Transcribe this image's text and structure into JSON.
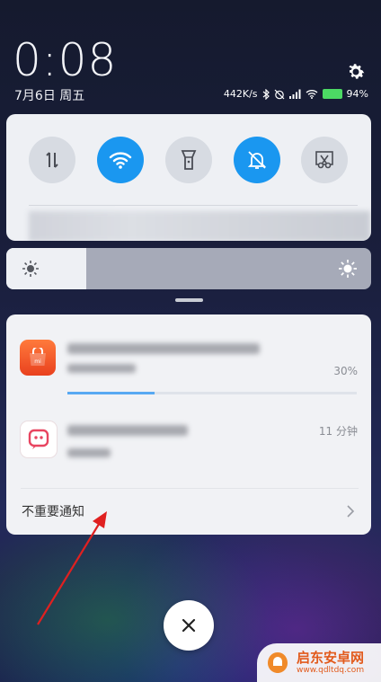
{
  "status": {
    "clock": "0:08",
    "date": "7月6日 周五",
    "net_speed": "442K/s",
    "battery_percent": "94%"
  },
  "quick_settings": {
    "tiles": [
      {
        "name": "data",
        "state": "off",
        "icon": "mobile-data-icon"
      },
      {
        "name": "wifi",
        "state": "on",
        "icon": "wifi-icon"
      },
      {
        "name": "flashlight",
        "state": "off",
        "icon": "flashlight-icon"
      },
      {
        "name": "mute",
        "state": "on",
        "icon": "bell-off-icon"
      },
      {
        "name": "screenshot",
        "state": "off",
        "icon": "scissors-icon"
      }
    ],
    "brightness_level": 0.22
  },
  "notifications": [
    {
      "app_icon": "mi-store-icon",
      "progress_percent": 30,
      "progress_label": "30%"
    },
    {
      "app_icon": "chat-app-icon",
      "time": "11 分钟"
    }
  ],
  "unimportant_label": "不重要通知",
  "watermark": {
    "title": "启东安卓网",
    "url": "www.qdltdq.com"
  },
  "colors": {
    "accent": "#1a97f0",
    "progress": "#58a9f2",
    "arrow": "#e02020"
  }
}
